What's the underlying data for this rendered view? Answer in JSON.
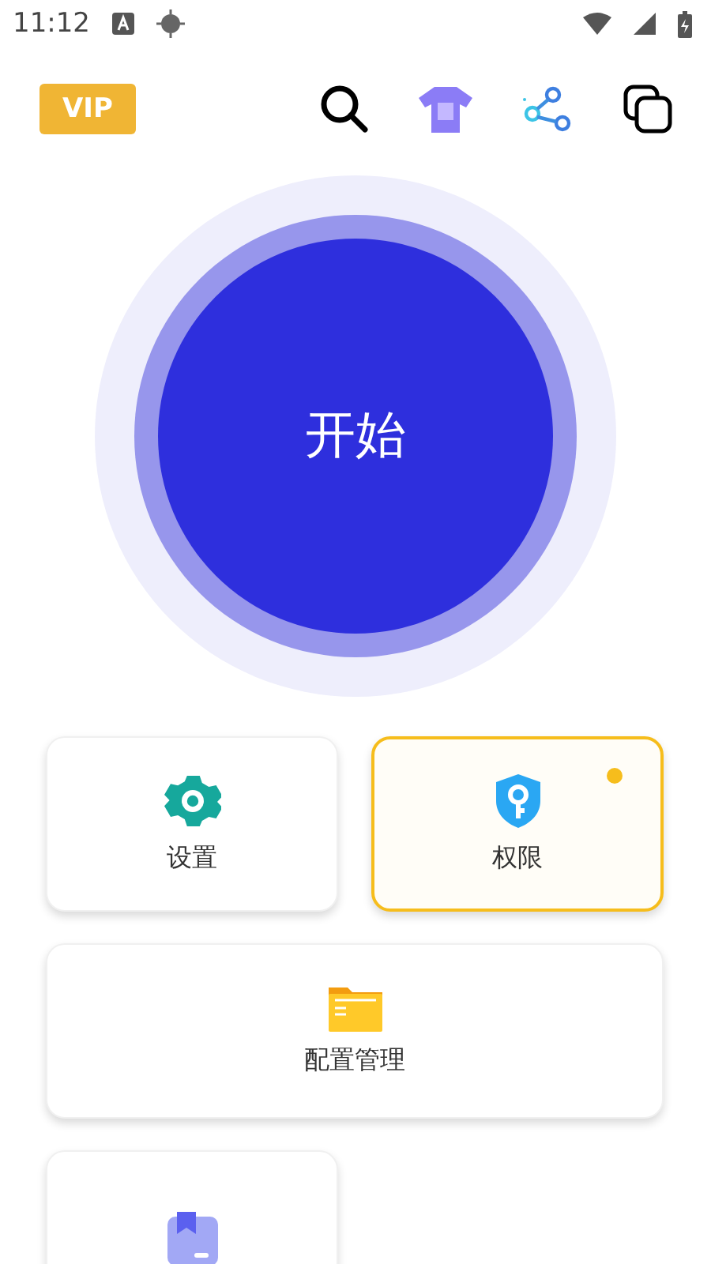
{
  "status_bar": {
    "time": "11:12"
  },
  "header": {
    "vip_label": "VIP"
  },
  "start_button": {
    "label": "开始"
  },
  "tiles": [
    {
      "kind": "half",
      "label": "设置",
      "selected": false,
      "alert": false
    },
    {
      "kind": "half",
      "label": "权限",
      "selected": true,
      "alert": true
    },
    {
      "kind": "wide",
      "label": "配置管理",
      "selected": false,
      "alert": false
    },
    {
      "kind": "half",
      "selected": false,
      "alert": false
    }
  ]
}
